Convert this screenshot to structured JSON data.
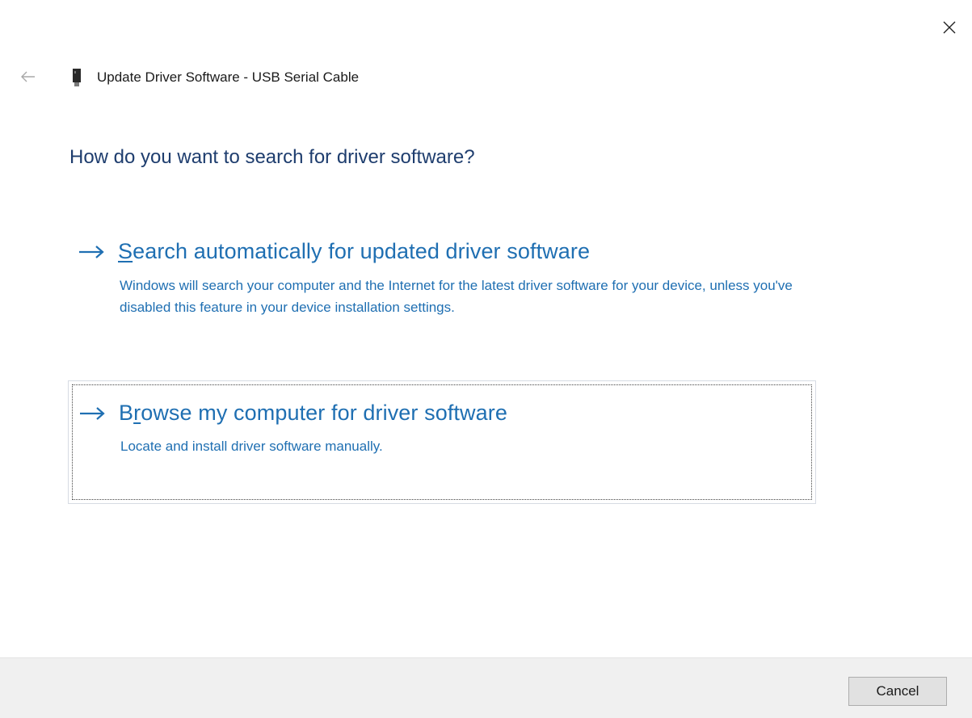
{
  "window": {
    "title": "Update Driver Software - USB Serial Cable"
  },
  "heading": "How do you want to search for driver software?",
  "options": [
    {
      "title_pre": "",
      "title_mnemonic": "S",
      "title_post": "earch automatically for updated driver software",
      "description": "Windows will search your computer and the Internet for the latest driver software for your device, unless you've disabled this feature in your device installation settings.",
      "focused": false
    },
    {
      "title_pre": "B",
      "title_mnemonic": "r",
      "title_post": "owse my computer for driver software",
      "description": "Locate and install driver software manually.",
      "focused": true
    }
  ],
  "footer": {
    "cancel_label": "Cancel"
  },
  "icons": {
    "close": "close-icon",
    "back": "back-arrow-icon",
    "device": "usb-device-icon",
    "option_arrow": "arrow-right-icon"
  },
  "colors": {
    "link": "#1f6fb2",
    "heading": "#1e3d6e",
    "footer_bg": "#f0f0f0"
  }
}
